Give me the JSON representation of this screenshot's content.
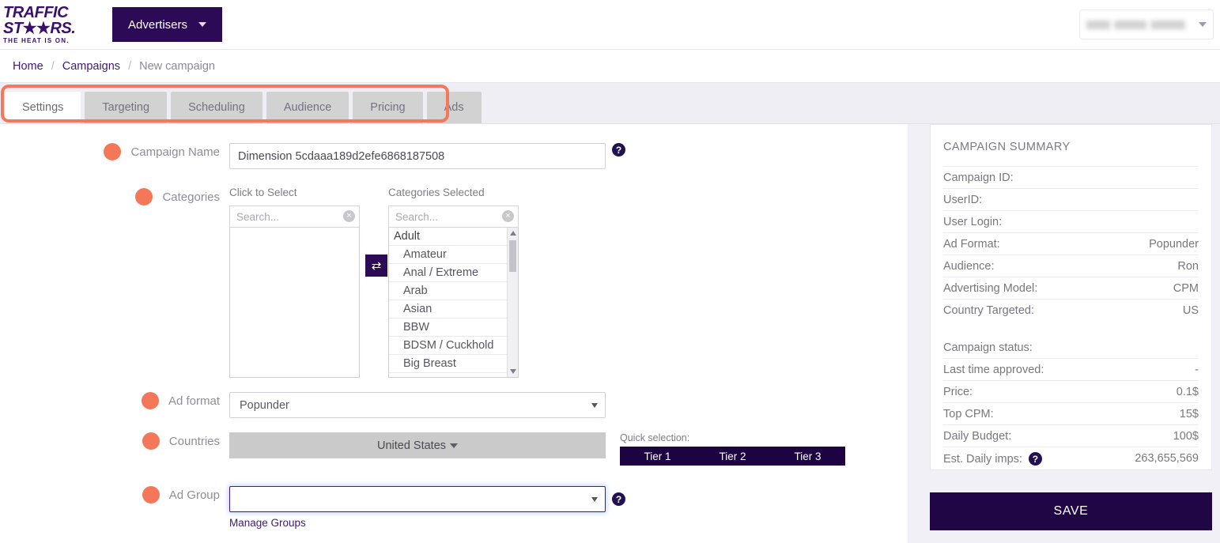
{
  "header": {
    "logo": {
      "line1": "TRAFFIC",
      "line2_pre": "ST",
      "line2_post": "RS.",
      "tagline": "THE HEAT IS ON."
    },
    "advertisers_label": "Advertisers",
    "user_menu_label": ""
  },
  "breadcrumb": {
    "home": "Home",
    "campaigns": "Campaigns",
    "current": "New campaign",
    "separator": "/"
  },
  "tabs": [
    {
      "label": "Settings",
      "active": true
    },
    {
      "label": "Targeting",
      "active": false
    },
    {
      "label": "Scheduling",
      "active": false
    },
    {
      "label": "Audience",
      "active": false
    },
    {
      "label": "Pricing",
      "active": false
    },
    {
      "label": "Ads",
      "active": false
    }
  ],
  "form": {
    "campaign_name": {
      "label": "Campaign Name",
      "value": "Dimension 5cdaaa189d2efe6868187508"
    },
    "categories": {
      "label": "Categories",
      "left_title": "Click to Select",
      "right_title": "Categories Selected",
      "search_placeholder": "Search...",
      "left_items": [],
      "right_items": [
        {
          "label": "Adult",
          "group": true
        },
        {
          "label": "Amateur",
          "group": false
        },
        {
          "label": "Anal / Extreme",
          "group": false
        },
        {
          "label": "Arab",
          "group": false
        },
        {
          "label": "Asian",
          "group": false
        },
        {
          "label": "BBW",
          "group": false
        },
        {
          "label": "BDSM / Cuckhold",
          "group": false
        },
        {
          "label": "Big Breast",
          "group": false
        }
      ],
      "swap_icon": "⇄"
    },
    "ad_format": {
      "label": "Ad format",
      "value": "Popunder"
    },
    "countries": {
      "label": "Countries",
      "value": "United States"
    },
    "quick_selection": {
      "label": "Quick selection:",
      "tiers": [
        "Tier 1",
        "Tier 2",
        "Tier 3"
      ]
    },
    "ad_group": {
      "label": "Ad Group",
      "value": "",
      "manage_link": "Manage Groups"
    },
    "help_icon": "?"
  },
  "summary": {
    "title": "CAMPAIGN SUMMARY",
    "rows_top": [
      {
        "key": "Campaign ID:",
        "value": ""
      },
      {
        "key": "UserID:",
        "value": ""
      },
      {
        "key": "User Login:",
        "value": ""
      },
      {
        "key": "Ad Format:",
        "value": "Popunder"
      },
      {
        "key": "Audience:",
        "value": "Ron"
      },
      {
        "key": "Advertising Model:",
        "value": "CPM"
      },
      {
        "key": "Country Targeted:",
        "value": "US"
      }
    ],
    "rows_bottom": [
      {
        "key": "Campaign status:",
        "value": ""
      },
      {
        "key": "Last time approved:",
        "value": "-"
      },
      {
        "key": "Price:",
        "value": "0.1$"
      },
      {
        "key": "Top CPM:",
        "value": "15$"
      },
      {
        "key": "Daily Budget:",
        "value": "100$"
      },
      {
        "key": "Est. Daily imps:",
        "value": "263,655,569",
        "help": true
      }
    ],
    "save_label": "SAVE"
  },
  "colors": {
    "brand_purple": "#2c0a55",
    "accent_orange": "#f4785c",
    "dot_coral": "#f4775a",
    "page_bg": "#f2f0f7",
    "tier_bar": "#1d0342"
  }
}
